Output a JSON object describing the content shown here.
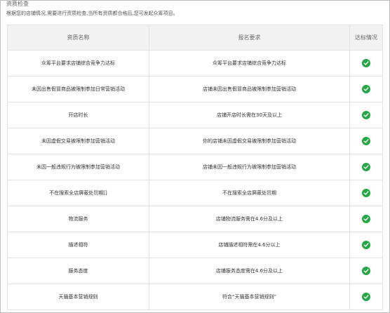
{
  "section": {
    "title": "资质检查",
    "description": "根据您的店铺情况,需要进行资质检查,当所有资质都合格后,您可发起众筹项目。"
  },
  "table": {
    "headers": [
      "资质名称",
      "报名要求",
      "达标情况"
    ],
    "rows": [
      {
        "name": "众筹平台要求店铺综合竞争力达标",
        "requirement": "众筹平台要求店铺综合竞争力达标",
        "status": "pass"
      },
      {
        "name": "未因出售假冒商品被限制参加日常营销活动",
        "requirement": "店铺未因出售假冒商品被限制参加营销活动",
        "status": "pass"
      },
      {
        "name": "开店时长",
        "requirement": "店铺开店时长需在30天及以上",
        "status": "pass"
      },
      {
        "name": "未因虚假交易被限制参加营销活动",
        "requirement": "你的店铺未因虚假交易被限制参加营销活动",
        "status": "pass"
      },
      {
        "name": "未因一般违规行为被限制参加营销活动",
        "requirement": "店铺未因一般违规行为被限制参加营销活动",
        "status": "pass"
      },
      {
        "name": "不在搜索全店屏蔽处罚期[]",
        "requirement": "不在搜索全店屏蔽处罚期",
        "status": "pass"
      },
      {
        "name": "物流服务",
        "requirement": "店铺物流服务需在4.6分及以上",
        "status": "pass"
      },
      {
        "name": "描述相符",
        "requirement": "店铺描述相符需在4.6分以上",
        "status": "pass"
      },
      {
        "name": "服务态度",
        "requirement": "店铺服务态度需在4.6分及以上",
        "status": "pass"
      },
      {
        "name": "天猫基本营销规则",
        "requirement": "符合“天猫基本营销规则”",
        "status": "pass"
      }
    ]
  },
  "colors": {
    "pass": "#23a844"
  }
}
